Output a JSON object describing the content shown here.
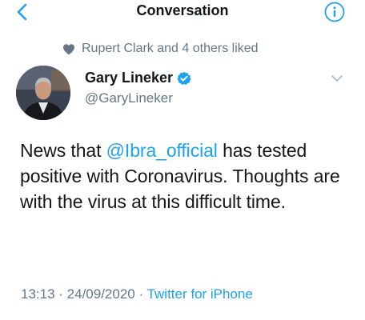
{
  "nav": {
    "title": "Conversation"
  },
  "social_context": {
    "text": "Rupert Clark and 4 others liked"
  },
  "author": {
    "name": "Gary Lineker",
    "handle": "@GaryLineker"
  },
  "tweet": {
    "text_before": "News that ",
    "mention": "@Ibra_official",
    "text_after": " has tested positive with Coronavirus. Thoughts are with the virus at this difficult time."
  },
  "meta": {
    "time": "13:13",
    "separator1": " · ",
    "date": "24/09/2020",
    "separator2": " · ",
    "source": "Twitter for iPhone"
  },
  "colors": {
    "accent": "#1da1f2",
    "text": "#14171a",
    "secondary": "#657786"
  },
  "icons": {
    "back": "chevron-left-icon",
    "info": "info-icon",
    "liked": "heart-icon",
    "verified": "verified-icon",
    "more": "chevron-down-icon"
  }
}
